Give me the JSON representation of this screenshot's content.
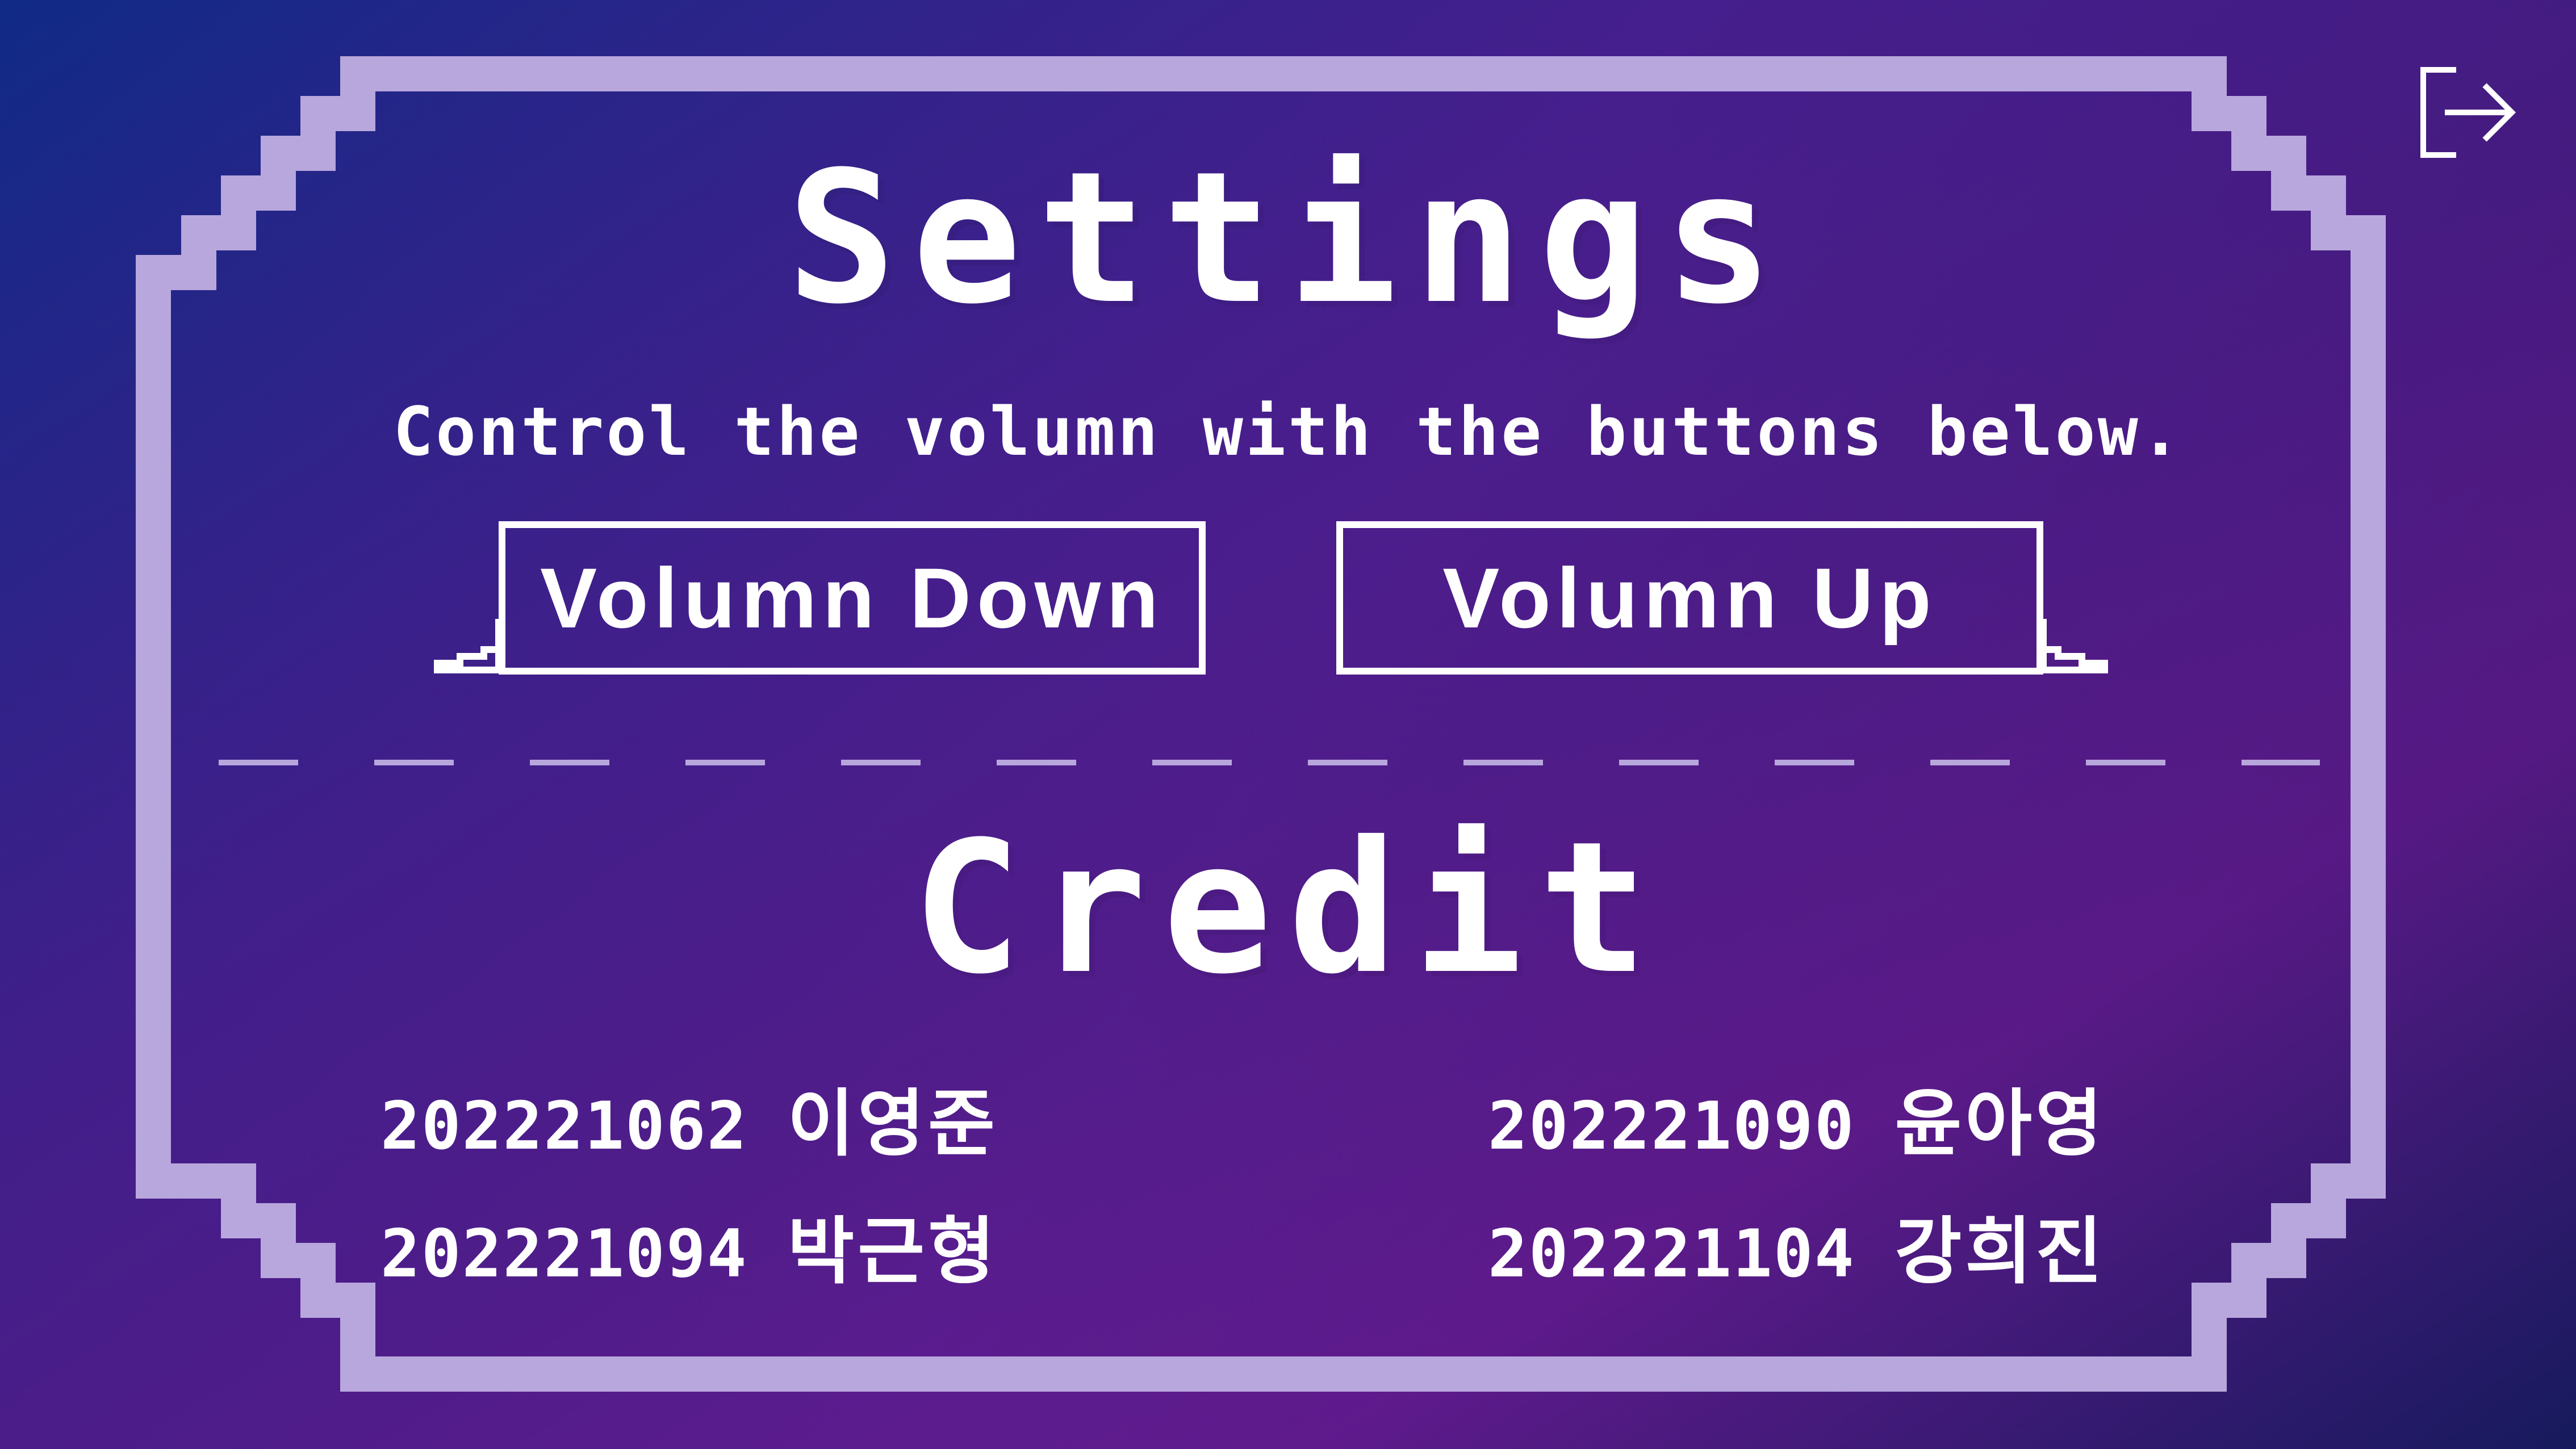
{
  "settings": {
    "title": "Settings",
    "subtitle": "Control the volumn with the buttons below.",
    "volume_down_label": "Volumn  Down",
    "volume_up_label": "Volumn  Up"
  },
  "credit": {
    "title": "Credit",
    "members": [
      {
        "id": "202221062",
        "name": "이영준"
      },
      {
        "id": "202221090",
        "name": "윤아영"
      },
      {
        "id": "202221094",
        "name": "박근형"
      },
      {
        "id": "202221104",
        "name": "강희진"
      }
    ]
  },
  "icons": {
    "exit": "exit-icon"
  },
  "colors": {
    "frame": "#b8a7dc",
    "text": "#ffffff",
    "bg_start": "#102a86",
    "bg_end": "#6a1a8e"
  }
}
